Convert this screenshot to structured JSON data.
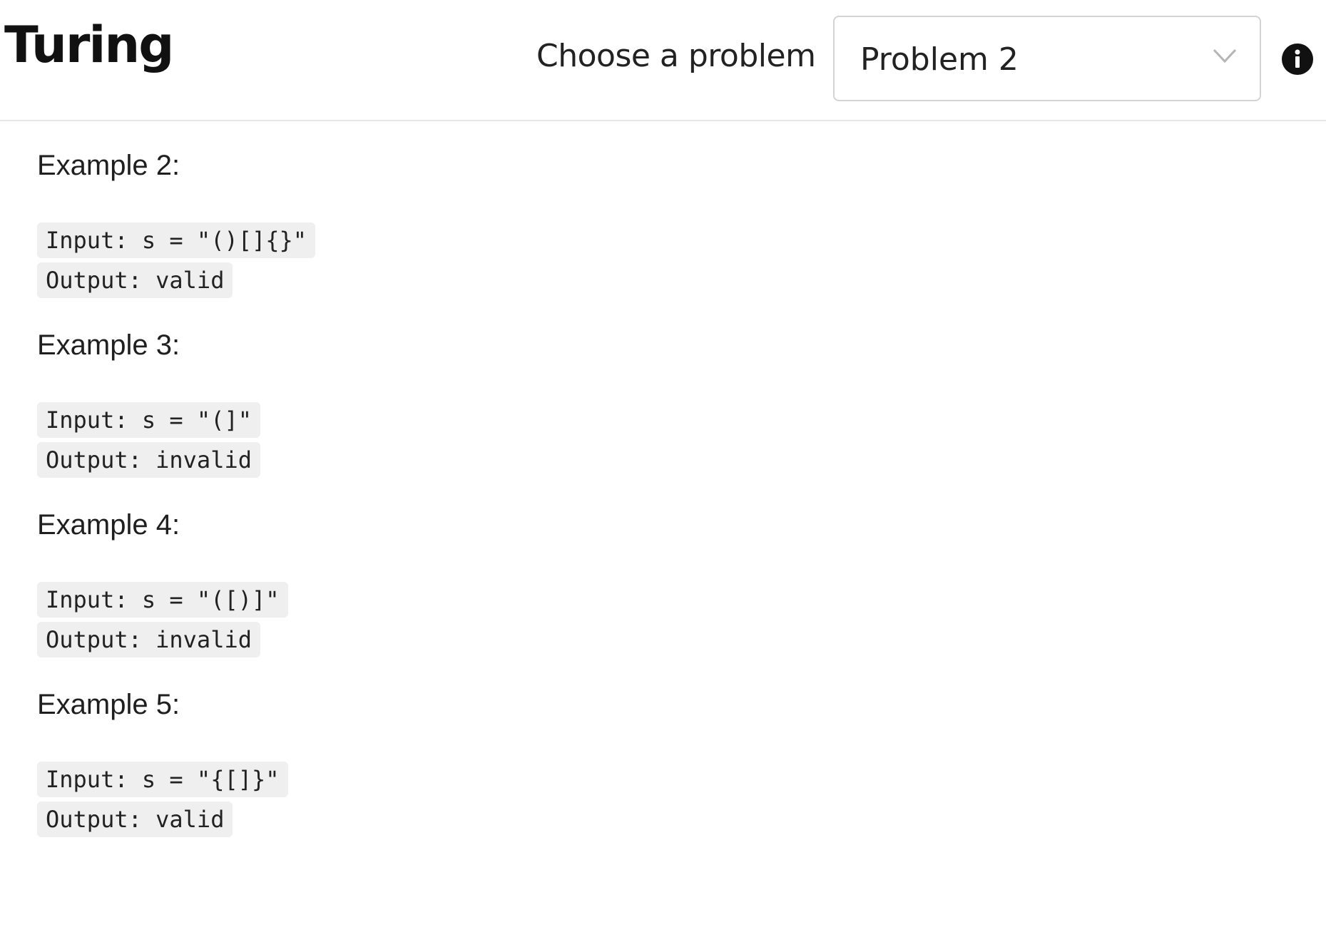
{
  "header": {
    "brand": "Turing",
    "choose_label": "Choose a problem",
    "select": {
      "value": "Problem 2",
      "icon": "chevron-down-icon"
    },
    "info_icon": "info-icon"
  },
  "examples": [
    {
      "heading": "Example 2:",
      "input": "Input: s = \"()[]{}\"",
      "output": "Output: valid"
    },
    {
      "heading": "Example 3:",
      "input": "Input: s = \"(]\"",
      "output": "Output: invalid"
    },
    {
      "heading": "Example 4:",
      "input": "Input: s = \"([)]\"",
      "output": "Output: invalid"
    },
    {
      "heading": "Example 5:",
      "input": "Input: s = \"{[]}\"",
      "output": "Output: valid"
    }
  ],
  "colors": {
    "text": "#1a1a1a",
    "code_bg": "#efefef",
    "border": "#d3d3d3",
    "divider": "#e6e6e6"
  }
}
